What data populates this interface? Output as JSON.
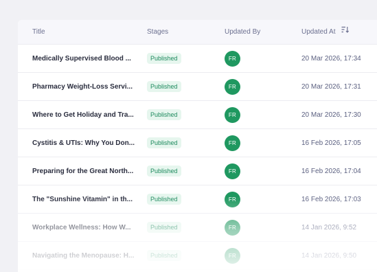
{
  "table": {
    "columns": {
      "title": "Title",
      "stages": "Stages",
      "updated_by": "Updated By",
      "updated_at": "Updated At"
    },
    "sort_icon": "sort-descending-icon",
    "rows": [
      {
        "title": "Medically Supervised Blood ...",
        "stage": "Published",
        "updated_by": "FR",
        "updated_at": "20 Mar 2026, 17:34"
      },
      {
        "title": "Pharmacy Weight-Loss Servi...",
        "stage": "Published",
        "updated_by": "FR",
        "updated_at": "20 Mar 2026, 17:31"
      },
      {
        "title": "Where to Get Holiday and Tra...",
        "stage": "Published",
        "updated_by": "FR",
        "updated_at": "20 Mar 2026, 17:30"
      },
      {
        "title": "Cystitis & UTIs: Why You Don...",
        "stage": "Published",
        "updated_by": "FR",
        "updated_at": "16 Feb 2026, 17:05"
      },
      {
        "title": "Preparing for the Great North...",
        "stage": "Published",
        "updated_by": "FR",
        "updated_at": "16 Feb 2026, 17:04"
      },
      {
        "title": "The \"Sunshine Vitamin\" in th...",
        "stage": "Published",
        "updated_by": "FR",
        "updated_at": "16 Feb 2026, 17:03"
      },
      {
        "title": "Workplace Wellness: How W...",
        "stage": "Published",
        "updated_by": "FR",
        "updated_at": "14 Jan 2026, 9:52"
      },
      {
        "title": "Navigating the Menopause: H...",
        "stage": "Published",
        "updated_by": "FR",
        "updated_at": "14 Jan 2026, 9:50"
      }
    ]
  },
  "colors": {
    "badge_text": "#1d8a5d",
    "badge_bg": "#e6f6ee",
    "avatar_bg": "#1f9860"
  }
}
